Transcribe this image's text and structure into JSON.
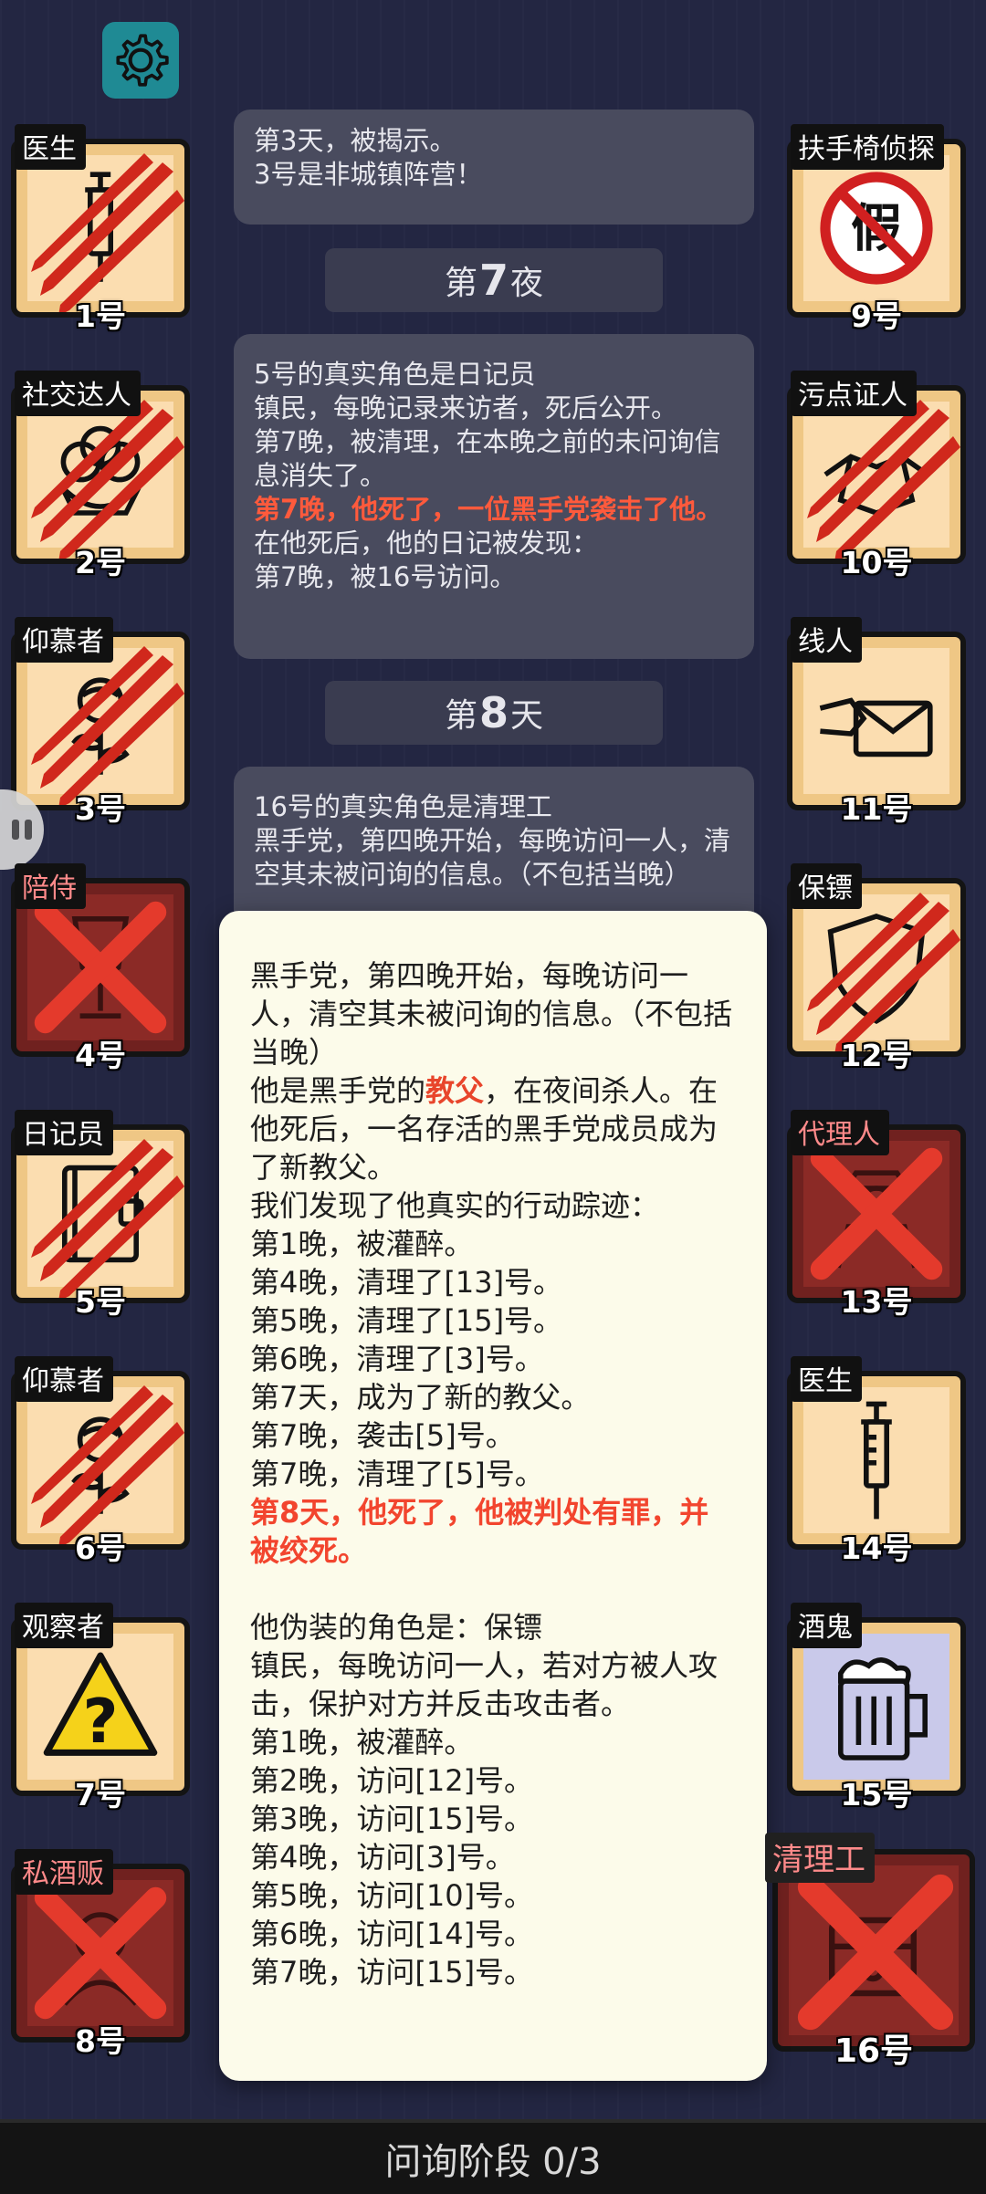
{
  "players": [
    {
      "num": "1号",
      "role": "医生",
      "icon": "syringe-icon",
      "state": "scratched"
    },
    {
      "num": "2号",
      "role": "社交达人",
      "icon": "flower-icon",
      "state": "scratched"
    },
    {
      "num": "3号",
      "role": "仰慕者",
      "icon": "rose-icon",
      "state": "scratched"
    },
    {
      "num": "4号",
      "role": "陪侍",
      "icon": "wine-glass-icon",
      "state": "dead"
    },
    {
      "num": "5号",
      "role": "日记员",
      "icon": "diary-icon",
      "state": "scratched"
    },
    {
      "num": "6号",
      "role": "仰慕者",
      "icon": "rose-icon",
      "state": "scratched"
    },
    {
      "num": "7号",
      "role": "观察者",
      "icon": "warning-question-icon",
      "state": "alive"
    },
    {
      "num": "8号",
      "role": "私酒贩",
      "icon": "bootlegger-icon",
      "state": "dead"
    },
    {
      "num": "9号",
      "role": "扶手椅侦探",
      "icon": "fake-stamp-icon",
      "state": "alive"
    },
    {
      "num": "10号",
      "role": "污点证人",
      "icon": "handshake-icon",
      "state": "scratched"
    },
    {
      "num": "11号",
      "role": "线人",
      "icon": "envelope-icon",
      "state": "alive"
    },
    {
      "num": "12号",
      "role": "保镖",
      "icon": "shield-icon",
      "state": "scratched"
    },
    {
      "num": "13号",
      "role": "代理人",
      "icon": "agent-icon",
      "state": "dead"
    },
    {
      "num": "14号",
      "role": "医生",
      "icon": "syringe-icon",
      "state": "alive"
    },
    {
      "num": "15号",
      "role": "酒鬼",
      "icon": "beer-mug-icon",
      "state": "drunk"
    },
    {
      "num": "16号",
      "role": "清理工",
      "icon": "cleaner-icon",
      "state": "dead"
    }
  ],
  "log": {
    "bubble1": [
      "第3天，被揭示。",
      "3号是非城镇阵营！"
    ],
    "header_night7": {
      "prefix": "第",
      "num": "7",
      "suffix": "夜"
    },
    "bubble2": {
      "l1": "5号的真实角色是日记员",
      "l2": "镇民，每晚记录来访者，死后公开。",
      "l3": "第7晚，被清理，在本晚之前的未问询信息消失了。",
      "red": "第7晚，他死了，一位黑手党袭击了他。",
      "l5": "在他死后，他的日记被发现：",
      "l6": "第7晚，被16号访问。"
    },
    "header_day8": {
      "prefix": "第",
      "num": "8",
      "suffix": "天"
    },
    "bubble3": [
      "16号的真实角色是清理工",
      "黑手党，第四晚开始，每晚访问一人，清空其未被问询的信息。（不包括当晚）"
    ]
  },
  "popup": {
    "p1": "黑手党，第四晚开始，每晚访问一人，清空其未被问询的信息。（不包括当晚）",
    "p2a": "他是黑手党的",
    "p2hl": "教父",
    "p2b": "，在夜间杀人。在他死后，一名存活的黑手党成员成为了新教父。",
    "p3": "我们发现了他真实的行动踪迹：",
    "actions": [
      "第1晚，被灌醉。",
      "第4晚，清理了[13]号。",
      "第5晚，清理了[15]号。",
      "第6晚，清理了[3]号。",
      "第7天，成为了新的教父。",
      "第7晚，袭击[5]号。",
      "第7晚，清理了[5]号。"
    ],
    "death": "第8天，他死了，他被判处有罪，并被绞死。",
    "disguise": "他伪装的角色是：保镖",
    "disguise_desc": "镇民，每晚访问一人，若对方被人攻击，保护对方并反击攻击者。",
    "visits": [
      "第1晚，被灌醉。",
      "第2晚，访问[12]号。",
      "第3晚，访问[15]号。",
      "第4晚，访问[3]号。",
      "第5晚，访问[10]号。",
      "第6晚，访问[14]号。",
      "第7晚，访问[15]号。"
    ]
  },
  "bottom_bar": "问询阶段 0/3",
  "colors": {
    "background": "#232642",
    "card": "#fbddb0",
    "dead": "#8b2a26",
    "scratch": "#d0281c",
    "accent_red": "#f2452e"
  }
}
